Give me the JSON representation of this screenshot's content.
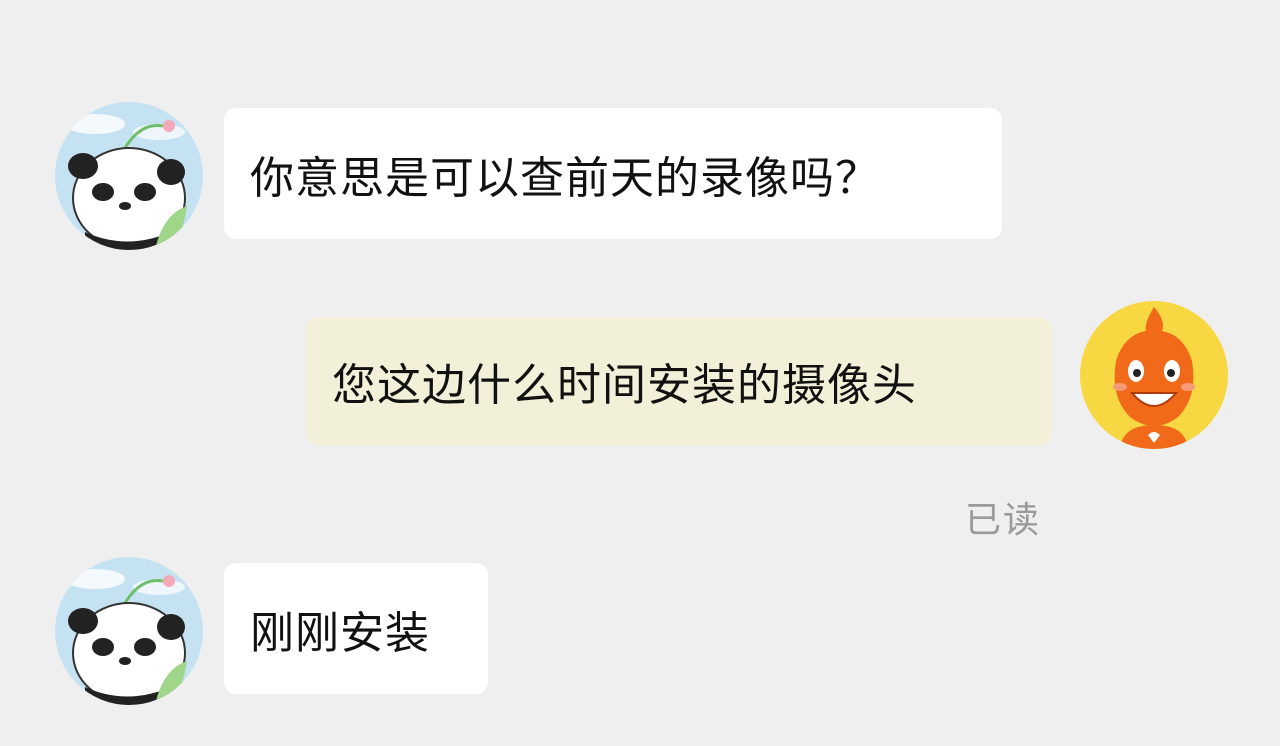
{
  "colors": {
    "background": "#efefef",
    "incoming_bubble": "#ffffff",
    "outgoing_bubble": "#f2f0d9",
    "message_text": "#111111",
    "read_status_text": "#9a9a9a"
  },
  "contact": {
    "avatar_icon": "panda-avatar-icon"
  },
  "me": {
    "avatar_icon": "orange-mascot-avatar-icon"
  },
  "messages": [
    {
      "direction": "incoming",
      "text": "你意思是可以查前天的录像吗？"
    },
    {
      "direction": "outgoing",
      "text": "您这边什么时间安装的摄像头",
      "status": "已读"
    },
    {
      "direction": "incoming",
      "text": "刚刚安装"
    }
  ]
}
